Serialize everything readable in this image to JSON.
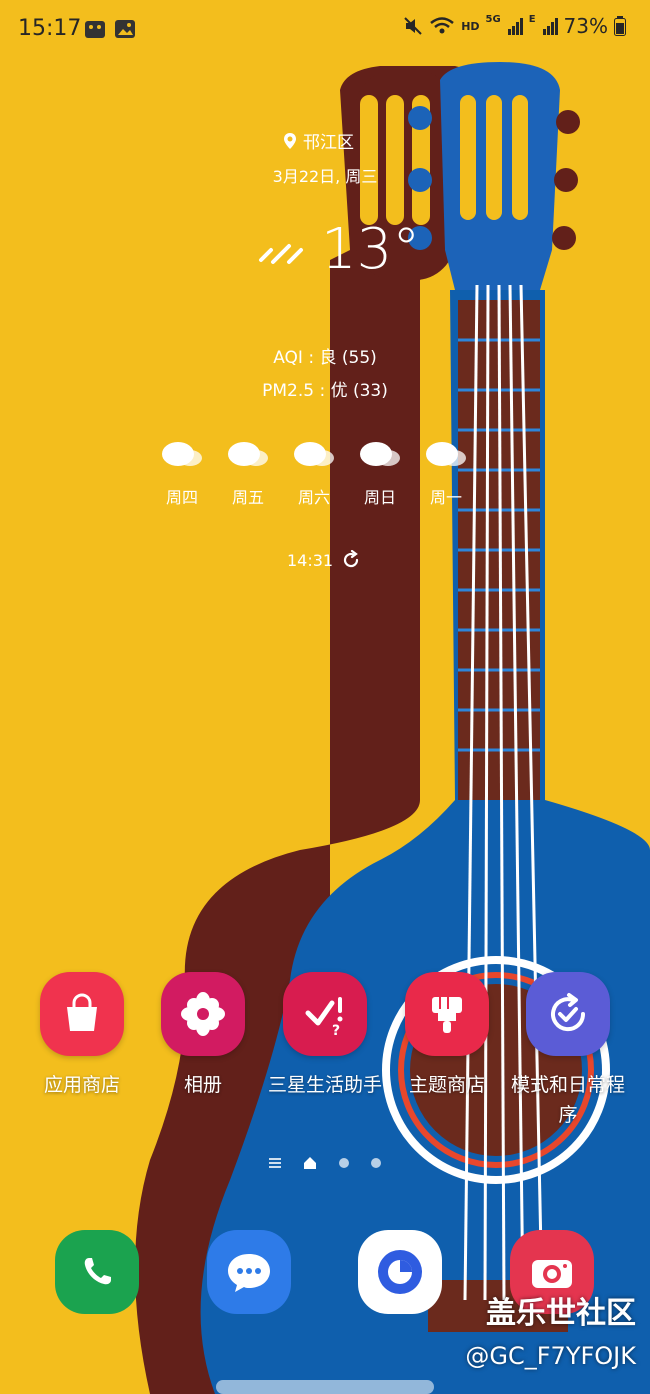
{
  "status_bar": {
    "time": "15:17",
    "network_label": "HD",
    "signal_5g": "5G",
    "signal_e": "E",
    "battery": "73%"
  },
  "weather": {
    "location": "邗江区",
    "date": "3月22日, 周三",
    "temperature": "13°",
    "aqi": "AQI : 良 (55)",
    "pm25": "PM2.5 : 优 (33)",
    "forecast": [
      {
        "day": "周四",
        "icon": "cloud-icon"
      },
      {
        "day": "周五",
        "icon": "cloud-icon"
      },
      {
        "day": "周六",
        "icon": "cloud-icon"
      },
      {
        "day": "周日",
        "icon": "cloud-icon"
      },
      {
        "day": "周一",
        "icon": "cloud-icon"
      }
    ],
    "updated_time": "14:31"
  },
  "apps": [
    {
      "label": "应用商店",
      "icon": "shopping-bag-icon",
      "color": "#F0334E"
    },
    {
      "label": "相册",
      "icon": "flower-icon",
      "color": "#D21B61"
    },
    {
      "label": "三星生活助手",
      "icon": "check-exclaim-icon",
      "color": "#D81C4F"
    },
    {
      "label": "主题商店",
      "icon": "paintbrush-icon",
      "color": "#E9294A"
    },
    {
      "label": "模式和日常程序",
      "icon": "routine-check-icon",
      "color": "#5B5CD6"
    }
  ],
  "dock": [
    {
      "name": "phone",
      "icon": "phone-icon",
      "color": "#1BA34F"
    },
    {
      "name": "messages",
      "icon": "chat-bubble-icon",
      "color": "#2E7BE8"
    },
    {
      "name": "browser",
      "icon": "internet-icon",
      "color": "#FFFFFF"
    },
    {
      "name": "camera",
      "icon": "camera-icon",
      "color": "#E4354F"
    }
  ],
  "watermark": {
    "line1": "盖乐世社区",
    "line2": "@GC_F7YFOJK"
  }
}
